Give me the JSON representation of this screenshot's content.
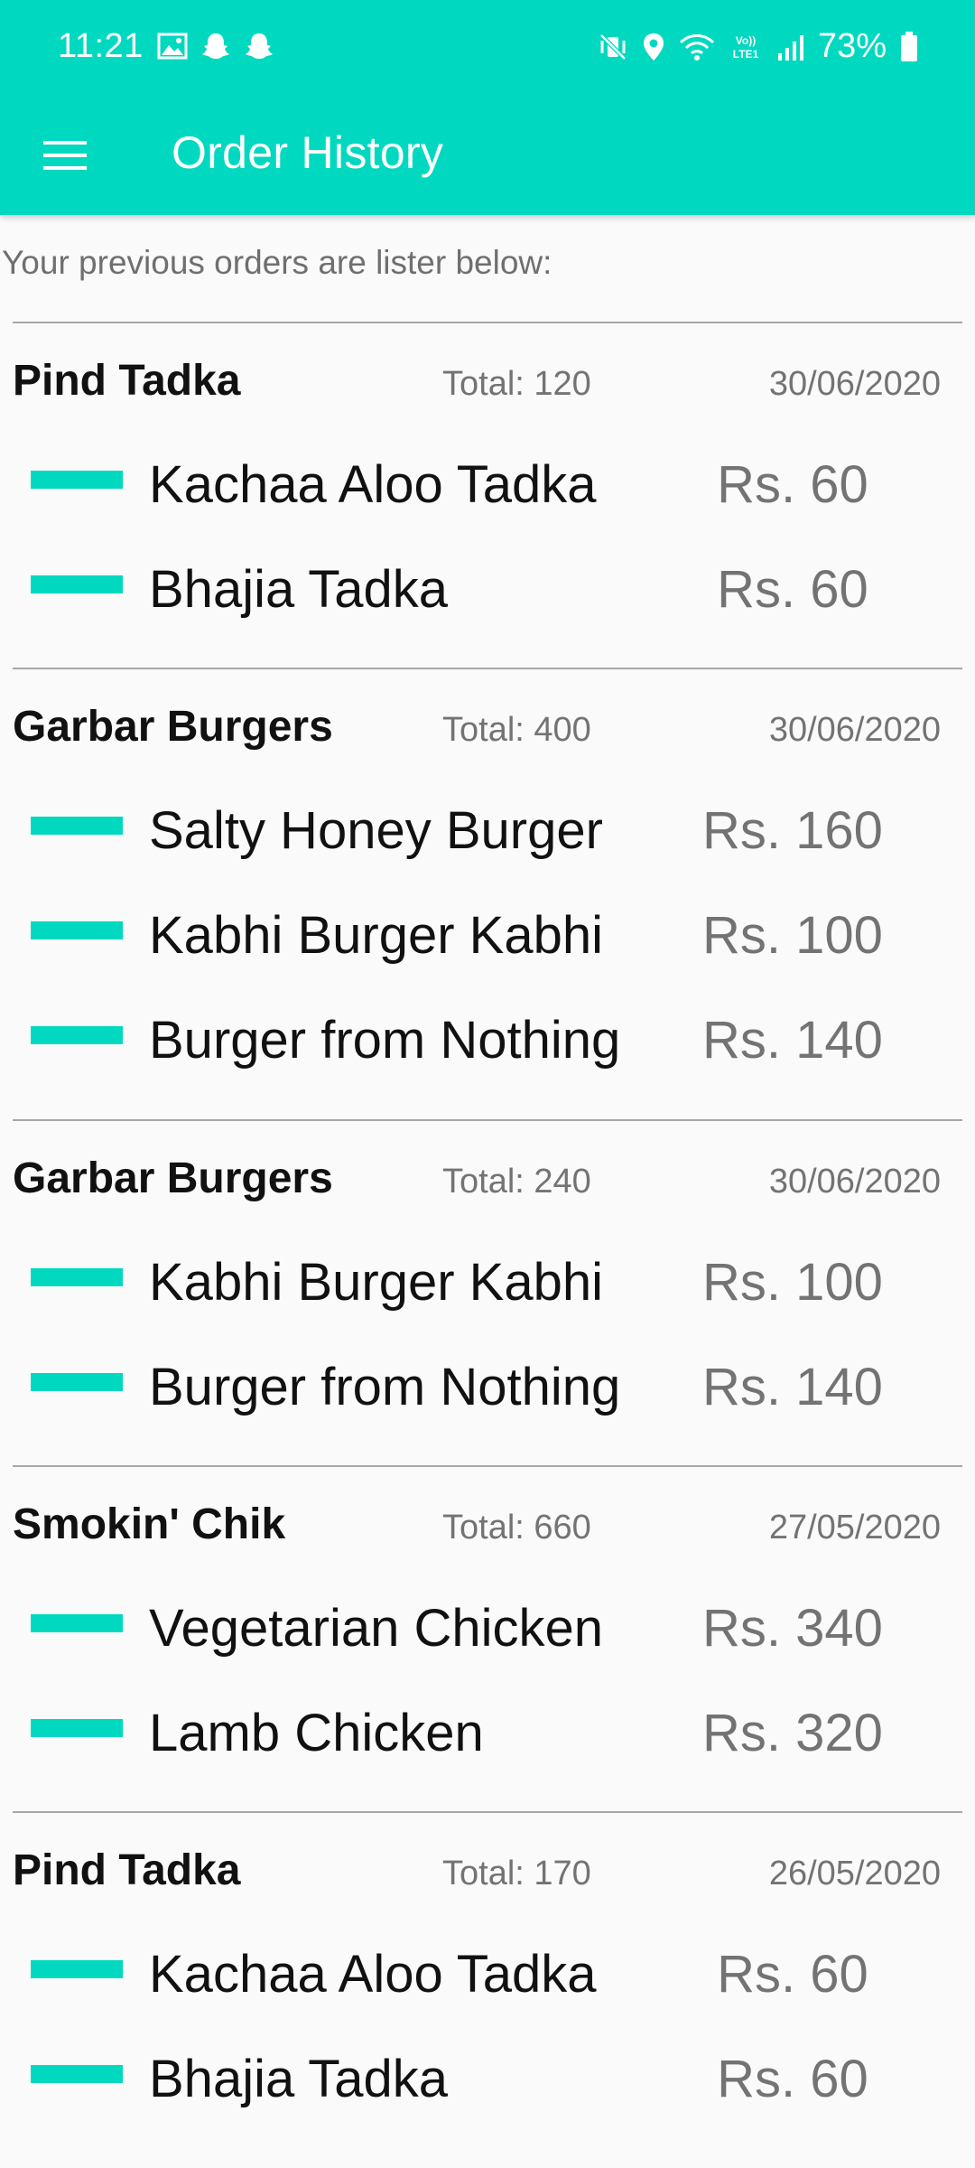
{
  "status_bar": {
    "time": "11:21",
    "battery": "73%",
    "network_label": "VoLTE1",
    "left_icons": [
      "gallery-icon",
      "snapchat-icon",
      "snapchat-icon"
    ],
    "right_icons": [
      "mute-vibrate-icon",
      "location-icon",
      "wifi-icon",
      "volte-icon",
      "signal-icon",
      "battery-icon"
    ]
  },
  "toolbar": {
    "title": "Order History",
    "menu_icon": "hamburger-menu-icon"
  },
  "colors": {
    "accent": "#00d9c0",
    "background": "#fafafa",
    "divider": "#a6a6a6",
    "muted_text": "#737373",
    "primary_text": "#111111"
  },
  "subtitle": "Your previous orders are lister below:",
  "orders": [
    {
      "store": "Pind Tadka",
      "total": "Total: 120",
      "date": "30/06/2020",
      "items": [
        {
          "name": "Kachaa Aloo Tadka",
          "price": "Rs. 60"
        },
        {
          "name": "Bhajia Tadka",
          "price": "Rs. 60"
        }
      ]
    },
    {
      "store": "Garbar Burgers",
      "total": "Total: 400",
      "date": "30/06/2020",
      "items": [
        {
          "name": "Salty Honey Burger",
          "price": "Rs. 160"
        },
        {
          "name": "Kabhi Burger Kabhi",
          "price": "Rs. 100"
        },
        {
          "name": "Burger from Nothing",
          "price": "Rs. 140"
        }
      ]
    },
    {
      "store": "Garbar Burgers",
      "total": "Total: 240",
      "date": "30/06/2020",
      "items": [
        {
          "name": "Kabhi Burger Kabhi",
          "price": "Rs. 100"
        },
        {
          "name": "Burger from Nothing",
          "price": "Rs. 140"
        }
      ]
    },
    {
      "store": "Smokin' Chik",
      "total": "Total: 660",
      "date": "27/05/2020",
      "items": [
        {
          "name": "Vegetarian Chicken",
          "price": "Rs. 340"
        },
        {
          "name": "Lamb Chicken",
          "price": "Rs. 320"
        }
      ]
    },
    {
      "store": "Pind Tadka",
      "total": "Total: 170",
      "date": "26/05/2020",
      "items": [
        {
          "name": "Kachaa Aloo Tadka",
          "price": "Rs. 60"
        },
        {
          "name": "Bhajia Tadka",
          "price": "Rs. 60"
        }
      ]
    }
  ]
}
